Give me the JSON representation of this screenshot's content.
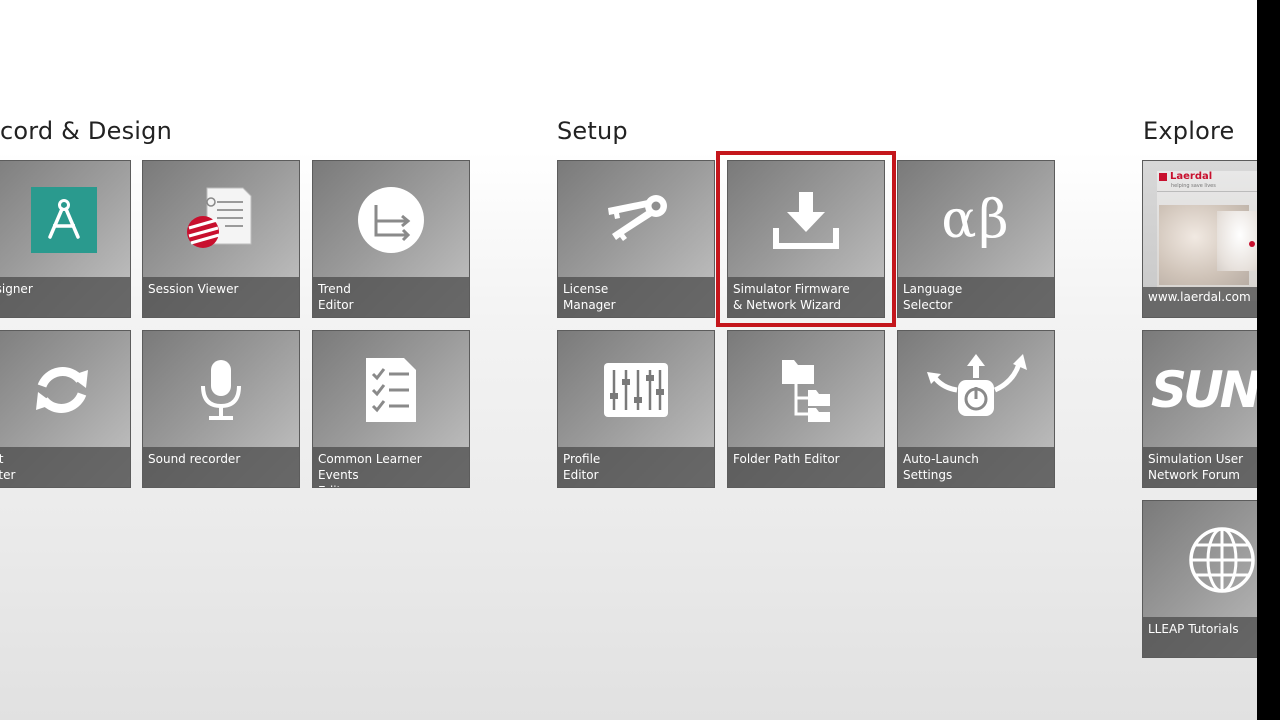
{
  "groups": {
    "record_design": {
      "title": "cord & Design"
    },
    "setup": {
      "title": "Setup"
    },
    "explore": {
      "title": "Explore"
    }
  },
  "tiles": {
    "designer": {
      "label": "Designer",
      "icon": "compass-icon"
    },
    "session_viewer": {
      "label": "Session Viewer",
      "icon": "document-icon"
    },
    "trend_editor": {
      "label": "Trend\nEditor",
      "icon": "graph-axis-icon"
    },
    "content_converter": {
      "label": "tent\nverter",
      "icon": "refresh-icon"
    },
    "sound_recorder": {
      "label": "Sound recorder",
      "icon": "microphone-icon"
    },
    "common_learner_events": {
      "label": "Common Learner Events\nEditor",
      "icon": "checklist-icon"
    },
    "license_manager": {
      "label": "License\nManager",
      "icon": "keys-icon"
    },
    "simulator_firmware": {
      "label": "Simulator Firmware\n& Network Wizard",
      "icon": "download-icon"
    },
    "language_selector": {
      "label": "Language\nSelector",
      "icon": "alpha-beta-icon",
      "glyph": "αβ"
    },
    "profile_editor": {
      "label": "Profile\nEditor",
      "icon": "sliders-icon"
    },
    "folder_path_editor": {
      "label": "Folder Path Editor",
      "icon": "folder-tree-icon"
    },
    "auto_launch": {
      "label": "Auto-Launch\nSettings",
      "icon": "power-arrows-icon"
    },
    "laerdal_web": {
      "label": "www.laerdal.com",
      "icon": "website-thumbnail",
      "logo_text": "Laerdal",
      "tagline": "helping save lives"
    },
    "sun_forum": {
      "label": "Simulation User\nNetwork Forum",
      "icon": "sun-logo-icon",
      "glyph": "SUN"
    },
    "lleap_tutorials": {
      "label": "LLEAP Tutorials",
      "icon": "globe-icon"
    }
  },
  "colors": {
    "selection": "#c4161c",
    "designer_icon_bg": "#2a9a8e"
  }
}
